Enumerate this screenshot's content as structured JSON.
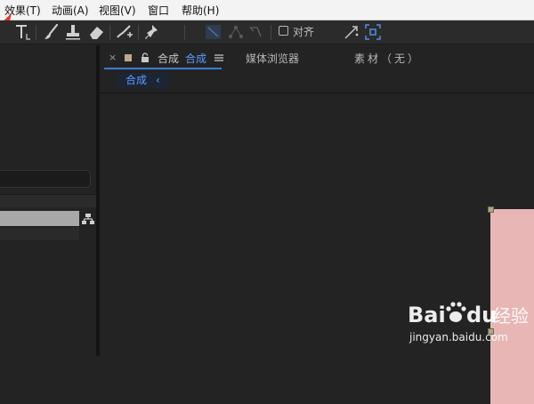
{
  "menu": {
    "items": [
      "效果(T)",
      "动画(A)",
      "视图(V)",
      "窗口",
      "帮助(H)"
    ]
  },
  "toolbar": {
    "snap_label": "对齐"
  },
  "panel": {
    "tab_prefix": "合成",
    "tab_name": "合成",
    "media_browser": "媒体浏览器",
    "footage": "素材（无）",
    "breadcrumb": "合成",
    "breadcrumb_chevron": "‹"
  },
  "watermark": {
    "logo_text": "Bai du 经验",
    "url": "jingyan.baidu.com"
  },
  "colors": {
    "accent": "#5f9cff",
    "layer": "#e8b6b4",
    "handle": "#aea487",
    "arrow": "#e8332a"
  }
}
